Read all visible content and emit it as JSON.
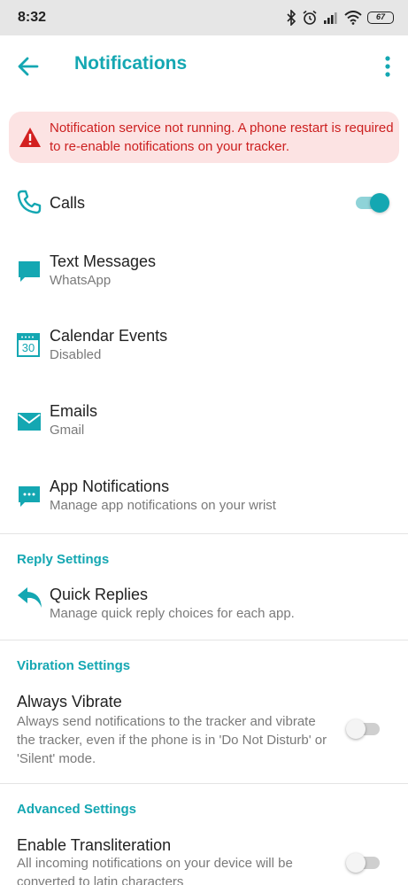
{
  "status_bar": {
    "time": "8:32",
    "battery": "67",
    "icons": [
      "bluetooth-icon",
      "alarm-icon",
      "signal-icon",
      "wifi-icon",
      "battery-icon"
    ]
  },
  "app_bar": {
    "title": "Notifications",
    "back_icon": "arrow-back-icon",
    "more_icon": "more-vertical-icon"
  },
  "alert": {
    "text": "Notification service not running. A phone restart is required to re-enable notifications on your tracker.",
    "icon": "warning-icon",
    "color": "#cc1f1f",
    "background": "#fce3e3"
  },
  "theme": {
    "accent": "#14a7b2",
    "text": "#222222",
    "secondary_text": "#7a7a7a"
  },
  "notification_items": [
    {
      "title": "Calls",
      "subtitle": "",
      "icon": "phone-icon",
      "toggle_on": true
    },
    {
      "title": "Text Messages",
      "subtitle": "WhatsApp",
      "icon": "message-icon"
    },
    {
      "title": "Calendar Events",
      "subtitle": "Disabled",
      "icon": "calendar-icon",
      "icon_text": "30"
    },
    {
      "title": "Emails",
      "subtitle": "Gmail",
      "icon": "email-icon"
    },
    {
      "title": "App Notifications",
      "subtitle": "Manage app notifications on your wrist",
      "icon": "app-notification-icon"
    }
  ],
  "reply_settings": {
    "header": "Reply Settings",
    "quick_replies": {
      "title": "Quick Replies",
      "subtitle": "Manage quick reply choices for each app.",
      "icon": "reply-icon"
    }
  },
  "vibration_settings": {
    "header": "Vibration Settings",
    "always_vibrate": {
      "title": "Always Vibrate",
      "description": "Always send notifications to the tracker and vibrate the tracker, even if the phone is in 'Do Not Disturb' or 'Silent' mode.",
      "toggle_on": false
    }
  },
  "advanced_settings": {
    "header": "Advanced Settings",
    "transliteration": {
      "title": "Enable Transliteration",
      "description": "All incoming notifications on your device will be converted to latin characters",
      "toggle_on": false
    }
  }
}
